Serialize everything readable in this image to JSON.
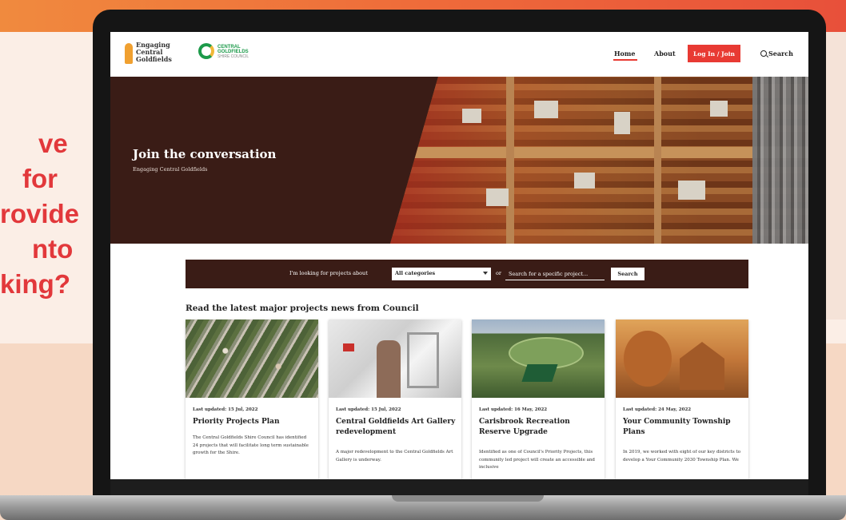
{
  "promo_text": [
    "ve",
    "for",
    "rovide",
    "nto",
    "king?"
  ],
  "header": {
    "logo1_lines": [
      "Engaging",
      "Central",
      "Goldfields"
    ],
    "logo2_lines": [
      "CENTRAL",
      "GOLDFIELDS",
      "SHIRE COUNCIL"
    ],
    "nav": {
      "home": "Home",
      "about": "About",
      "login": "Log In / Join",
      "search": "Search"
    }
  },
  "hero": {
    "title": "Join the conversation",
    "subtitle": "Engaging Central Goldfields"
  },
  "search_bar": {
    "label": "I'm looking for projects about",
    "category_selected": "All categories",
    "or_text": "or",
    "placeholder": "Search for a specific project...",
    "button": "Search"
  },
  "news_heading": "Read the latest major projects news from Council",
  "cards": [
    {
      "date": "Last updated: 15 Jul, 2022",
      "title": "Priority Projects Plan",
      "body": "The Central Goldfields Shire Council has identified 24 projects that will facilitate long term sustainable growth for the Shire."
    },
    {
      "date": "Last updated: 15 Jul, 2022",
      "title": "Central Goldfields Art Gallery redevelopment",
      "body": "A major redevelopment to the Central Goldfields Art Gallery is underway."
    },
    {
      "date": "Last updated: 16 May, 2022",
      "title": "Carisbrook Recreation Reserve Upgrade",
      "body": "Identified as one of Council's Priority Projects, this community led project will create an accessible and inclusive"
    },
    {
      "date": "Last updated: 24 May, 2022",
      "title": "Your Community Township Plans",
      "body": "In 2019, we worked with eight of our key districts to develop a Your Community 2030 Township Plan. We"
    }
  ],
  "colors": {
    "accent": "#e83a33",
    "hero_bg": "#3a1c16",
    "promo": "#e2383b"
  }
}
